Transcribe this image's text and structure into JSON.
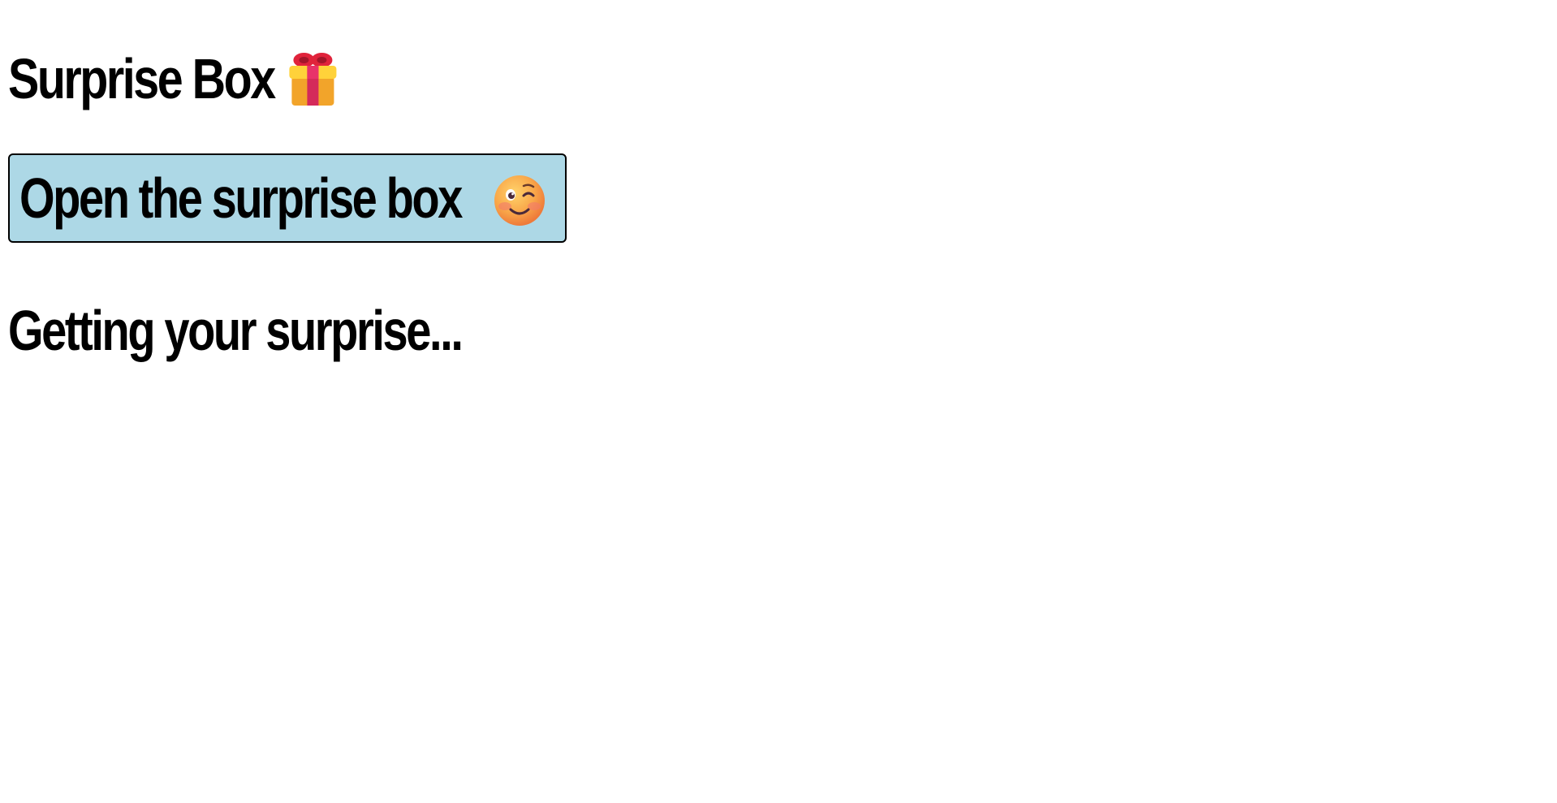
{
  "header": {
    "title": "Surprise Box",
    "title_icon": "gift-icon"
  },
  "main": {
    "open_button_label": "Open the surprise box",
    "open_button_icon": "winking-face-icon",
    "open_button_color": "#add8e6",
    "status_text": "Getting your surprise..."
  }
}
